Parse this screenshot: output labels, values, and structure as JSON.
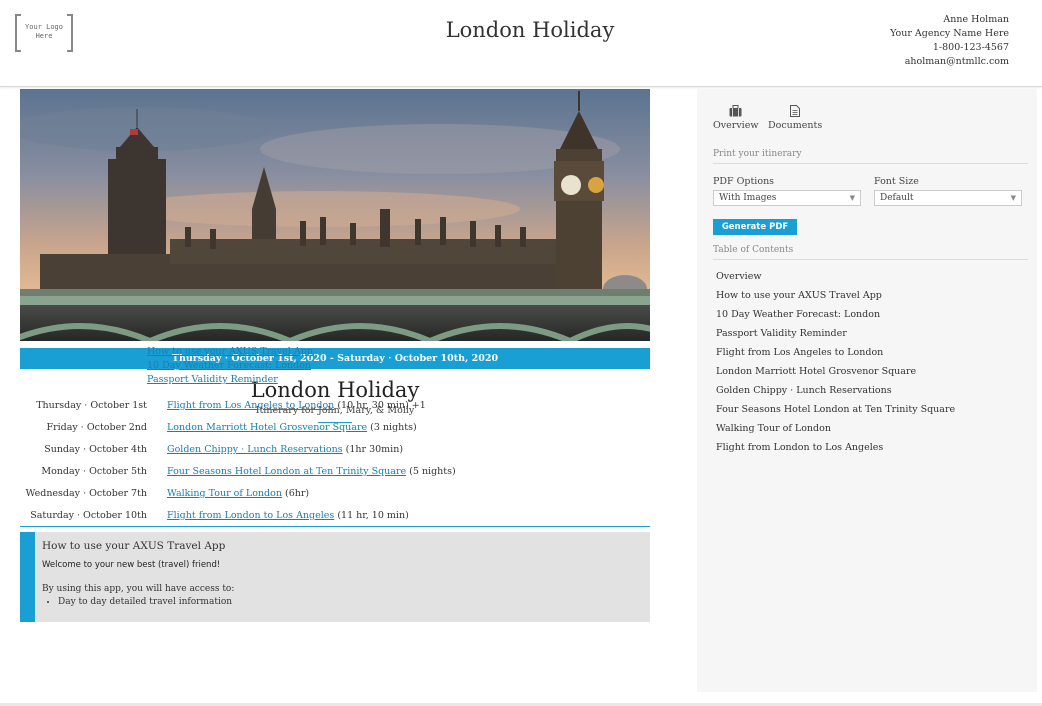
{
  "header": {
    "logo_line1": "Your Logo",
    "logo_line2": "Here",
    "title": "London Holiday",
    "agent_name": "Anne Holman",
    "agency": "Your Agency Name Here",
    "phone": "1-800-123-4567",
    "email": "aholman@ntmllc.com"
  },
  "trip": {
    "dates": "Thursday · October 1st, 2020 - Saturday · October 10th, 2020",
    "title": "London Holiday",
    "subtitle": "Itinerary for John, Mary, & Molly",
    "general_links": [
      "How to use your AXUS Travel App",
      "10 Day Weather Forecast: London",
      "Passport Validity Reminder"
    ],
    "schedule": [
      {
        "date": "Thursday · October 1st",
        "link": "Flight from Los Angeles to London",
        "note": "(10 hr, 30 min) +1"
      },
      {
        "date": "Friday · October 2nd",
        "link": "London Marriott Hotel Grosvenor Square",
        "note": "(3 nights)"
      },
      {
        "date": "Sunday · October 4th",
        "link": "Golden Chippy · Lunch Reservations",
        "note": "(1hr 30min)"
      },
      {
        "date": "Monday · October 5th",
        "link": "Four Seasons Hotel London at Ten Trinity Square",
        "note": "(5 nights)"
      },
      {
        "date": "Wednesday · October 7th",
        "link": "Walking Tour of London",
        "note": "(6hr)"
      },
      {
        "date": "Saturday · October 10th",
        "link": "Flight from London to Los Angeles",
        "note": "(11 hr, 10 min)"
      }
    ]
  },
  "info_box": {
    "heading": "How to use your AXUS Travel App",
    "welcome": "Welcome to your new best (travel) friend!",
    "access": "By using this app, you will have access to:",
    "bullet1": "Day to day detailed travel information"
  },
  "sidebar": {
    "tab_overview": "Overview",
    "tab_documents": "Documents",
    "print_heading": "Print your itinerary",
    "pdf_options_label": "PDF Options",
    "pdf_options_value": "With Images",
    "font_size_label": "Font Size",
    "font_size_value": "Default",
    "generate_button": "Generate PDF",
    "toc_heading": "Table of Contents",
    "toc": [
      "Overview",
      "How to use your AXUS Travel App",
      "10 Day Weather Forecast: London",
      "Passport Validity Reminder",
      "Flight from Los Angeles to London",
      "London Marriott Hotel Grosvenor Square",
      "Golden Chippy · Lunch Reservations",
      "Four Seasons Hotel London at Ten Trinity Square",
      "Walking Tour of London",
      "Flight from London to Los Angeles"
    ]
  },
  "colors": {
    "accent": "#1a9fd4",
    "link": "#1a7db3",
    "sidebar_bg": "#f6f6f6"
  },
  "icons": {
    "overview": "suitcase-icon",
    "documents": "document-icon",
    "dropdown": "chevron-down-icon"
  }
}
